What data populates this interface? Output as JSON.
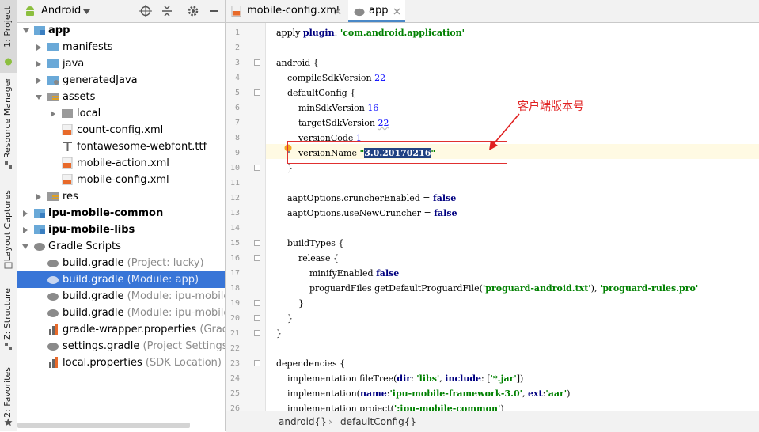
{
  "toolstrip": {
    "tabs": [
      {
        "label": "1: Project"
      },
      {
        "label": "Resource Manager"
      },
      {
        "label": "Layout Captures"
      },
      {
        "label": "Z: Structure"
      },
      {
        "label": "2: Favorites"
      }
    ]
  },
  "project": {
    "view_label": "Android",
    "tree": [
      {
        "label": "app",
        "hint": "",
        "icon": "module-folder-icon"
      },
      {
        "label": "manifests",
        "hint": "",
        "icon": "folder-icon"
      },
      {
        "label": "java",
        "hint": "",
        "icon": "folder-icon"
      },
      {
        "label": "generatedJava",
        "hint": "",
        "icon": "generated-folder-icon"
      },
      {
        "label": "assets",
        "hint": "",
        "icon": "assets-folder-icon"
      },
      {
        "label": "local",
        "hint": "",
        "icon": "folder-icon"
      },
      {
        "label": "count-config.xml",
        "hint": "",
        "icon": "xml-file-icon"
      },
      {
        "label": "fontawesome-webfont.ttf",
        "hint": "",
        "icon": "font-file-icon"
      },
      {
        "label": "mobile-action.xml",
        "hint": "",
        "icon": "xml-file-icon"
      },
      {
        "label": "mobile-config.xml",
        "hint": "",
        "icon": "xml-file-icon"
      },
      {
        "label": "res",
        "hint": "",
        "icon": "res-folder-icon"
      },
      {
        "label": "ipu-mobile-common",
        "hint": "",
        "icon": "module-folder-icon"
      },
      {
        "label": "ipu-mobile-libs",
        "hint": "",
        "icon": "module-folder-icon"
      },
      {
        "label": "Gradle Scripts",
        "hint": "",
        "icon": "gradle-icon"
      },
      {
        "label": "build.gradle",
        "hint": "(Project: lucky)",
        "icon": "gradle-icon"
      },
      {
        "label": "build.gradle",
        "hint": "(Module: app)",
        "icon": "gradle-icon"
      },
      {
        "label": "build.gradle",
        "hint": "(Module: ipu-mobile-c",
        "icon": "gradle-icon"
      },
      {
        "label": "build.gradle",
        "hint": "(Module: ipu-mobile-li",
        "icon": "gradle-icon"
      },
      {
        "label": "gradle-wrapper.properties",
        "hint": "(Gradle",
        "icon": "properties-file-icon"
      },
      {
        "label": "settings.gradle",
        "hint": "(Project Settings)",
        "icon": "gradle-icon"
      },
      {
        "label": "local.properties",
        "hint": "(SDK Location)",
        "icon": "properties-file-icon"
      }
    ]
  },
  "editor": {
    "tabs": [
      {
        "label": "mobile-config.xml"
      },
      {
        "label": "app"
      }
    ],
    "line_numbers": [
      "1",
      "2",
      "3",
      "4",
      "5",
      "6",
      "7",
      "8",
      "9",
      "10",
      "11",
      "12",
      "13",
      "14",
      "15",
      "16",
      "17",
      "18",
      "19",
      "20",
      "21",
      "22",
      "23",
      "24",
      "25",
      "26"
    ],
    "code": {
      "l1_a": "apply ",
      "l1_b": "plugin",
      "l1_c": ": ",
      "l1_d": "'com.android.application'",
      "l3": "android {",
      "l4_a": "    compileSdkVersion ",
      "l4_b": "22",
      "l5": "    defaultConfig {",
      "l6_a": "        minSdkVersion ",
      "l6_b": "16",
      "l7_a": "        targetSdkVersion ",
      "l7_b": "22",
      "l8_a": "        versionCode ",
      "l8_b": "1",
      "l9_a": "        versionName ",
      "l9_b": "\"",
      "l9_c": "3.0.20170216",
      "l9_d": "\"",
      "l10": "    }",
      "l12_a": "    aaptOptions.cruncherEnabled = ",
      "l12_b": "false",
      "l13_a": "    aaptOptions.useNewCruncher = ",
      "l13_b": "false",
      "l15": "    buildTypes {",
      "l16": "        release {",
      "l17_a": "            minifyEnabled ",
      "l17_b": "false",
      "l18_a": "            proguardFiles getDefaultProguardFile(",
      "l18_b": "'proguard-android.txt'",
      "l18_c": "), ",
      "l18_d": "'proguard-rules.pro'",
      "l19": "        }",
      "l20": "    }",
      "l21": "}",
      "l23": "dependencies {",
      "l24_a": "    implementation fileTree(",
      "l24_b": "dir",
      "l24_c": ": ",
      "l24_d": "'libs'",
      "l24_e": ", ",
      "l24_f": "include",
      "l24_g": ": [",
      "l24_h": "'*.jar'",
      "l24_i": "])",
      "l25_a": "    implementation(",
      "l25_b": "name",
      "l25_c": ":",
      "l25_d": "'ipu-mobile-framework-3.0'",
      "l25_e": ", ",
      "l25_f": "ext",
      "l25_g": ":",
      "l25_h": "'aar'",
      "l25_i": ")",
      "l26_a": "    implementation project(",
      "l26_b": "':ipu-mobile-common'",
      "l26_c": ")"
    },
    "annotation": "客户端版本号",
    "breadcrumbs": [
      "android{}",
      "defaultConfig{}"
    ],
    "breadcrumb_separator": "›"
  },
  "colors": {
    "selection": "#3875d7",
    "keyword": "#000080",
    "string": "#008000",
    "number": "#0000ff",
    "annotation": "#e02020"
  }
}
